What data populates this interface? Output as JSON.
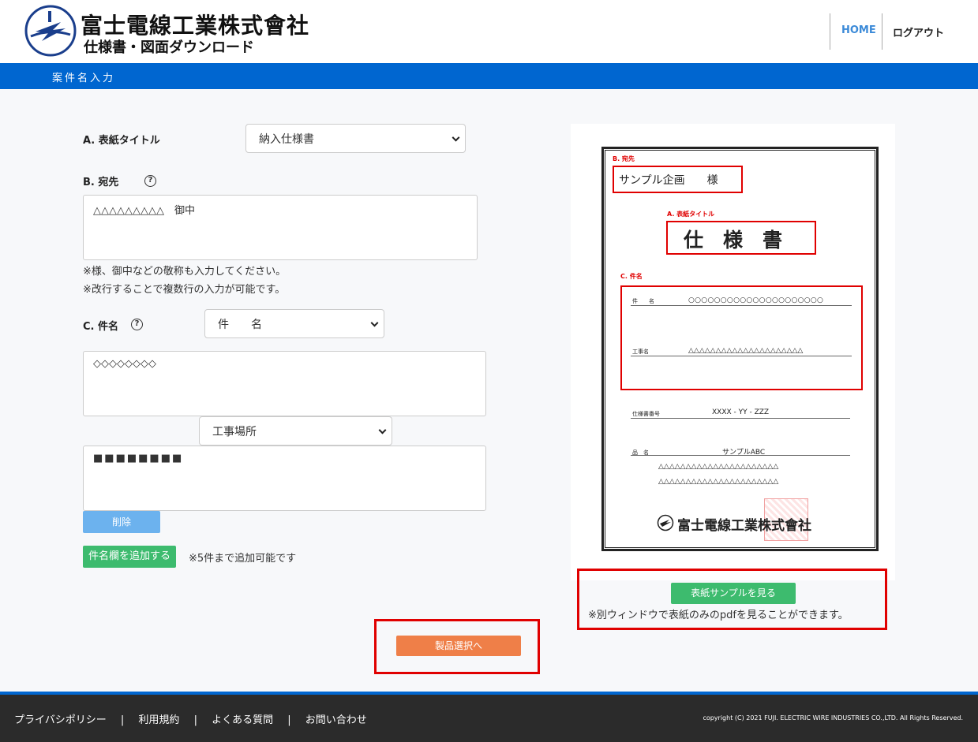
{
  "header": {
    "company_name": "富士電線工業株式會社",
    "subtitle": "仕様書・図面ダウンロード",
    "nav": {
      "home": "HOME",
      "logout": "ログアウト"
    }
  },
  "section_title": "案件名入力",
  "form": {
    "cover_title": {
      "label": "A. 表紙タイトル",
      "value": "納入仕様書"
    },
    "recipient": {
      "label": "B. 宛先",
      "value": "△△△△△△△△△　御中",
      "notes": [
        "※様、御中などの敬称も入力してください。",
        "※改行することで複数行の入力が可能です。"
      ]
    },
    "subject": {
      "label": "C. 件名",
      "select_value": "件　　名",
      "value": "◇◇◇◇◇◇◇◇",
      "second_select_value": "工事場所",
      "second_value": "■■■■■■■■",
      "delete_label": "削除",
      "add_label": "件名欄を追加する",
      "add_note": "※5件まで追加可能です"
    },
    "next_label": "製品選択へ"
  },
  "sample": {
    "recipient_tag": "B. 宛先",
    "recipient_text": "サンプル企画　　様",
    "title_tag": "A. 表紙タイトル",
    "title_text": "仕　様　書",
    "subject_tag": "C. 件名",
    "row1_label": "件　　名",
    "row1_value": "○○○○○○○○○○○○○○○○○○○○○",
    "row2_label": "工事名",
    "row2_value": "△△△△△△△△△△△△△△△△△△△△△",
    "spec_label": "仕様書番号",
    "spec_value": "XXXX - YY - ZZZ",
    "product_label": "品　名",
    "product_value": "サンプルABC",
    "product_line2": "△△△△△△△△△△△△△△△△△△△△△△",
    "product_line3": "△△△△△△△△△△△△△△△△△△△△△△",
    "company": "富士電線工業株式會社",
    "view_label": "表紙サンプルを見る",
    "view_note": "※別ウィンドウで表紙のみのpdfを見ることができます。"
  },
  "footer": {
    "links": [
      "プライバシポリシー",
      "|",
      "利用規約",
      "|",
      "よくある質問",
      "|",
      "お問い合わせ"
    ],
    "copyright": "copyright (C) 2021 FUJI. ELECTRIC WIRE INDUSTRIES CO.,LTD. All Rights Reserved."
  },
  "colors": {
    "brand_blue": "#0066d0",
    "green": "#3dbb6e",
    "orange": "#ef7f48",
    "light_blue": "#6cb2ee",
    "highlight_red": "#e00000"
  }
}
